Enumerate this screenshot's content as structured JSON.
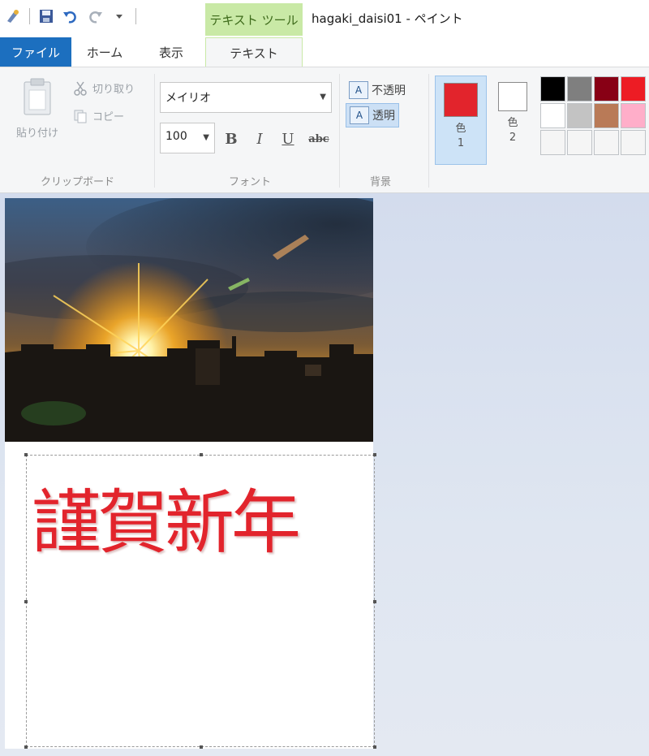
{
  "window": {
    "title": "hagaki_daisi01 - ペイント",
    "context_tab": "テキスト ツール"
  },
  "tabs": [
    {
      "label": "ファイル",
      "active": false
    },
    {
      "label": "ホーム",
      "active": false
    },
    {
      "label": "表示",
      "active": false
    },
    {
      "label": "テキスト",
      "active": true
    }
  ],
  "clipboard": {
    "paste": "貼り付け",
    "cut": "切り取り",
    "copy": "コピー",
    "group_label": "クリップボード"
  },
  "font": {
    "family": "メイリオ",
    "size": "100",
    "bold": "B",
    "italic": "I",
    "underline": "U",
    "strike": "abc",
    "group_label": "フォント"
  },
  "background": {
    "opaque": "不透明",
    "transparent": "透明",
    "selected": "transparent",
    "group_label": "背景"
  },
  "colors": {
    "color1_label": "色",
    "color1_num": "1",
    "color2_label": "色",
    "color2_num": "2",
    "color1": "#e2242c",
    "color2": "#ffffff",
    "palette": [
      "#000000",
      "#7f7f7f",
      "#880015",
      "#ed1c24",
      "#ffffff",
      "#c3c3c3",
      "#b97a57",
      "#ffaec9",
      "#f5f5f5",
      "#f5f5f5",
      "#f5f5f5",
      "#f5f5f5"
    ]
  },
  "canvas": {
    "greeting_text": "謹賀新年",
    "text_color": "#e2242c"
  }
}
